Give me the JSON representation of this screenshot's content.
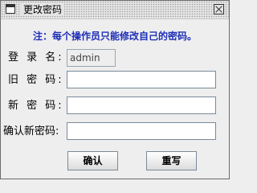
{
  "window": {
    "title": "更改密码"
  },
  "notice": "注：每个操作员只能修改自己的密码。",
  "form": {
    "username_label": "登 录 名:",
    "username_value": "admin",
    "old_password_label": "旧 密 码:",
    "old_password_value": "",
    "new_password_label": "新 密 码:",
    "new_password_value": "",
    "confirm_password_label": "确认新密码:",
    "confirm_password_value": ""
  },
  "buttons": {
    "confirm": "确认",
    "reset": "重写"
  },
  "colors": {
    "notice": "#1f2fb8",
    "background": "#eeeeee"
  }
}
